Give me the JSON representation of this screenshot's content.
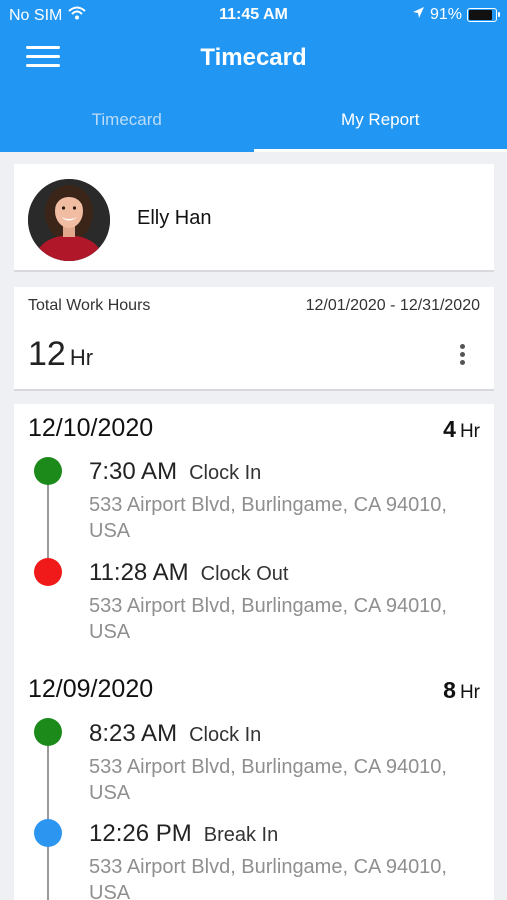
{
  "status_bar": {
    "carrier": "No SIM",
    "time": "11:45 AM",
    "battery": "91%",
    "battery_level": 0.91
  },
  "header": {
    "title": "Timecard"
  },
  "tabs": [
    {
      "label": "Timecard",
      "active": false
    },
    {
      "label": "My Report",
      "active": true
    }
  ],
  "profile": {
    "name": "Elly Han"
  },
  "summary": {
    "label": "Total Work Hours",
    "date_range": "12/01/2020 - 12/31/2020",
    "total": "12",
    "unit": "Hr"
  },
  "days": [
    {
      "date": "12/10/2020",
      "hours": "4",
      "unit": "Hr",
      "entries": [
        {
          "time": "7:30 AM",
          "action": "Clock In",
          "address": "533 Airport Blvd, Burlingame, CA 94010, USA",
          "color": "#1b8a1b"
        },
        {
          "time": "11:28 AM",
          "action": "Clock Out",
          "address": "533 Airport Blvd, Burlingame, CA 94010, USA",
          "color": "#f01a1a"
        }
      ]
    },
    {
      "date": "12/09/2020",
      "hours": "8",
      "unit": "Hr",
      "entries": [
        {
          "time": "8:23 AM",
          "action": "Clock In",
          "address": "533 Airport Blvd, Burlingame, CA 94010, USA",
          "color": "#1b8a1b"
        },
        {
          "time": "12:26 PM",
          "action": "Break In",
          "address": "533 Airport Blvd, Burlingame, CA 94010, USA",
          "color": "#2b95f0"
        }
      ]
    }
  ]
}
